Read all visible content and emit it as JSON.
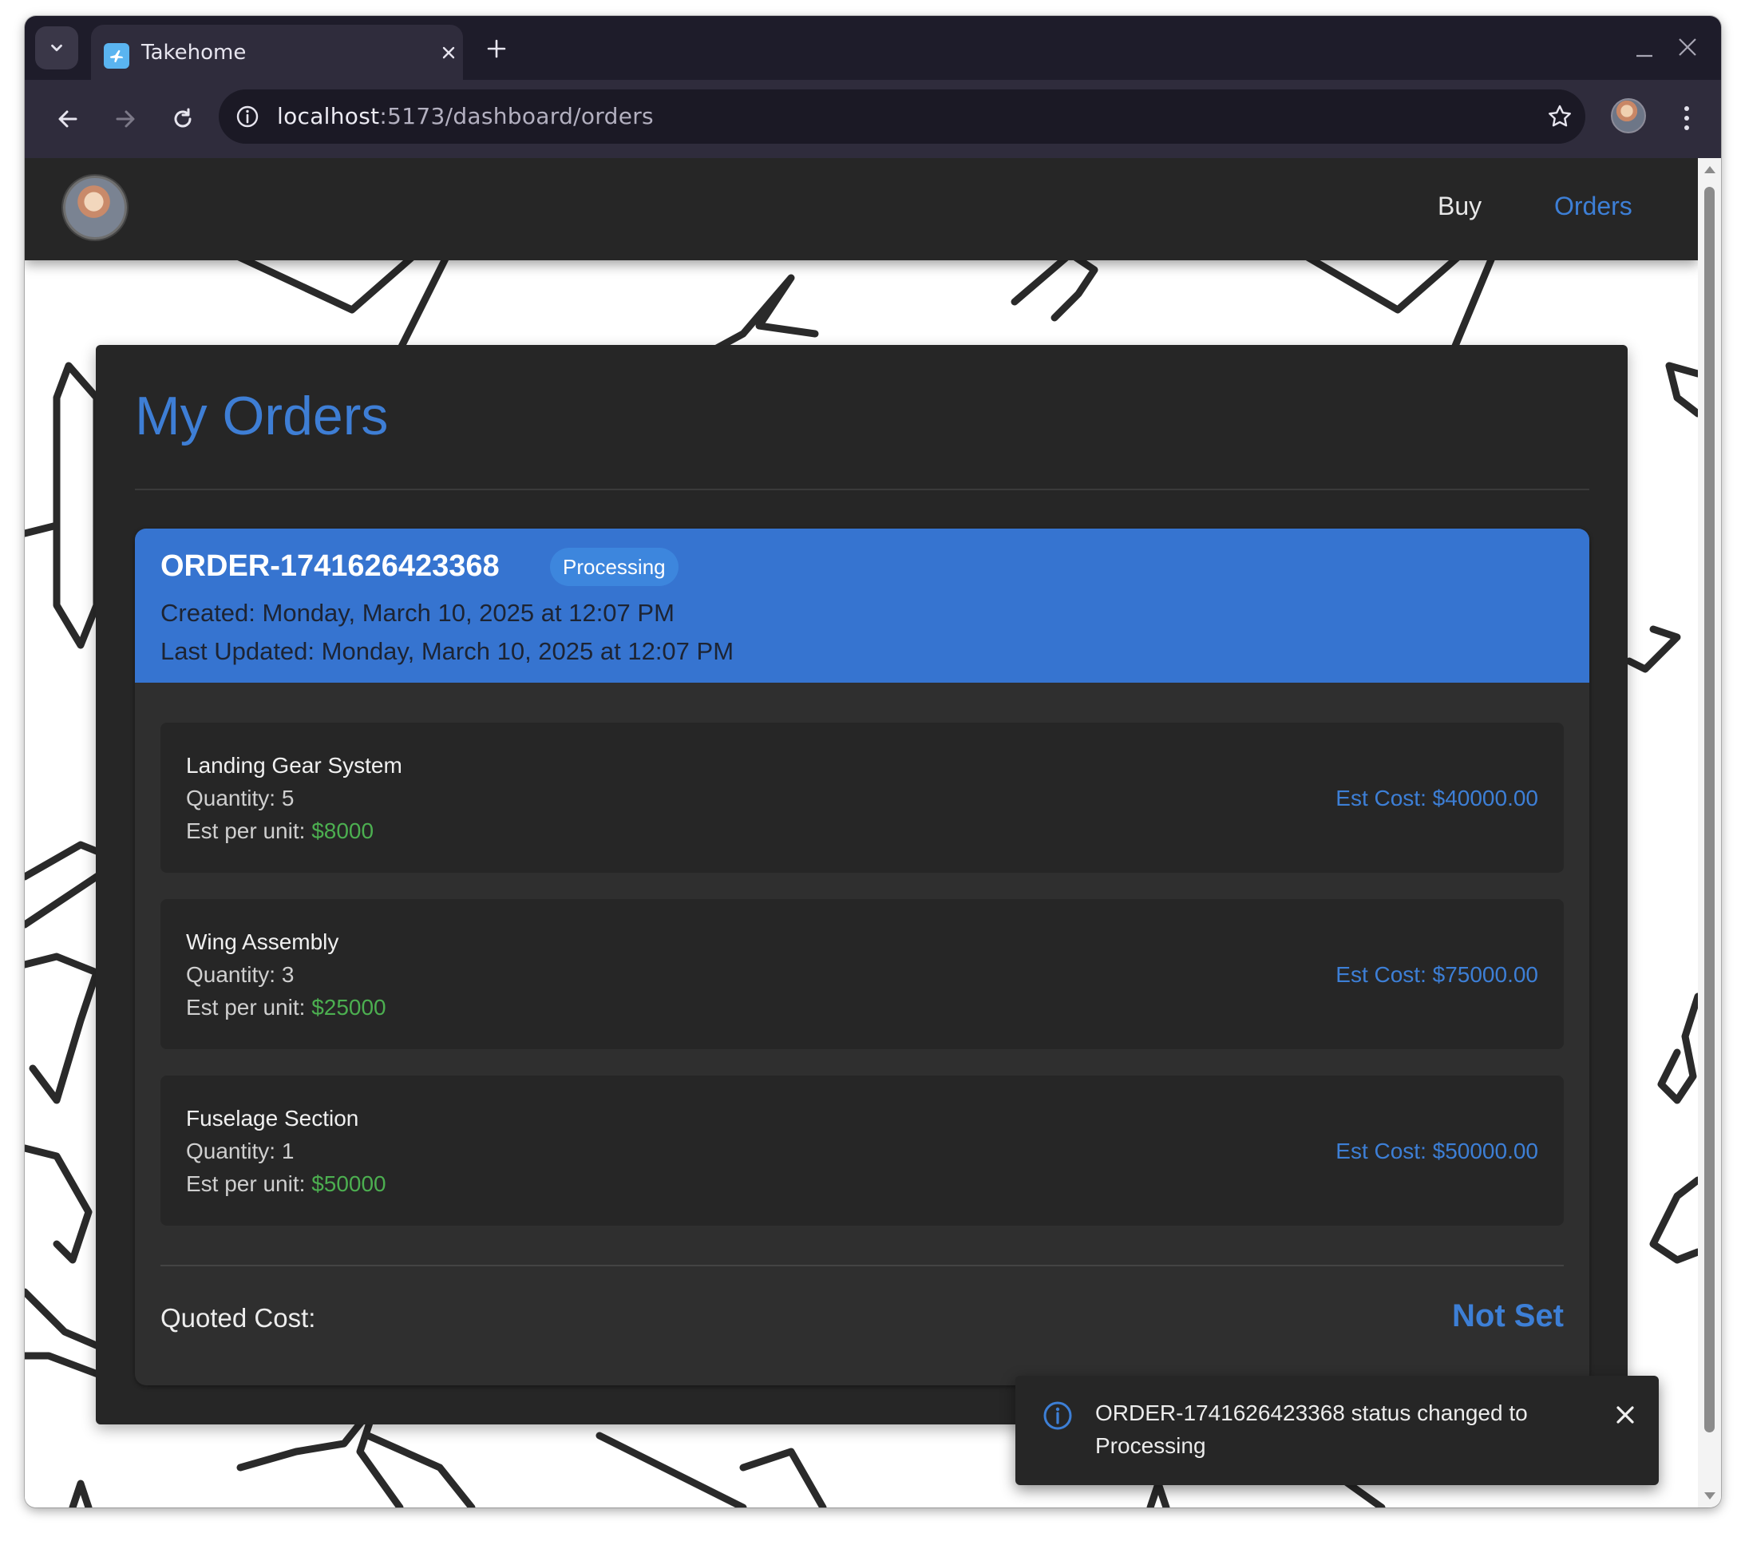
{
  "browser": {
    "tab_title": "Takehome",
    "url_host": "localhost",
    "url_rest": ":5173/dashboard/orders"
  },
  "nav": {
    "links": [
      {
        "label": "Buy"
      },
      {
        "label": "Orders"
      }
    ],
    "active_color": "#3d7fd6"
  },
  "page": {
    "title": "My Orders"
  },
  "order": {
    "id": "ORDER-1741626423368",
    "status": "Processing",
    "created": "Created: Monday, March 10, 2025 at 12:07 PM",
    "updated": "Last Updated: Monday, March 10, 2025 at 12:07 PM",
    "header_color": "#3674d0",
    "items": [
      {
        "name": "Landing Gear System",
        "quantity": "Quantity: 5",
        "unit_label": "Est per unit: ",
        "unit_price": "$8000",
        "est_cost": "Est Cost: $40000.00"
      },
      {
        "name": "Wing Assembly",
        "quantity": "Quantity: 3",
        "unit_label": "Est per unit: ",
        "unit_price": "$25000",
        "est_cost": "Est Cost: $75000.00"
      },
      {
        "name": "Fuselage Section",
        "quantity": "Quantity: 1",
        "unit_label": "Est per unit: ",
        "unit_price": "$50000",
        "est_cost": "Est Cost: $50000.00"
      }
    ],
    "quoted_label": "Quoted Cost:",
    "quoted_value": "Not Set"
  },
  "toast": {
    "message": "ORDER-1741626423368 status changed to Processing",
    "icon": "info-icon"
  }
}
